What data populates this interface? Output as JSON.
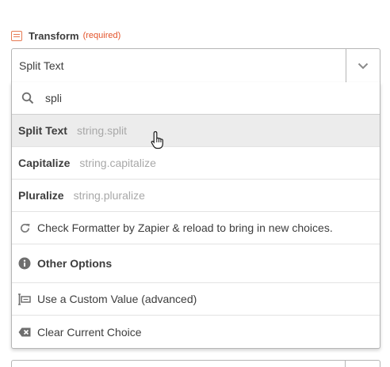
{
  "field": {
    "label": "Transform",
    "required_tag": "(required)",
    "label_icon": "formatter-icon",
    "accent_color": "#e3532a"
  },
  "select": {
    "value": "Split Text",
    "arrow_icon": "chevron-down-icon"
  },
  "search": {
    "value": "spli",
    "icon": "search-icon"
  },
  "options": [
    {
      "name": "Split Text",
      "key": "string.split",
      "highlighted": true
    },
    {
      "name": "Capitalize",
      "key": "string.capitalize",
      "highlighted": false
    },
    {
      "name": "Pluralize",
      "key": "string.pluralize",
      "highlighted": false
    }
  ],
  "actions": {
    "reload": "Check Formatter by Zapier & reload to bring in new choices.",
    "other_options": "Other Options",
    "custom_value": "Use a Custom Value (advanced)",
    "clear_choice": "Clear Current Choice"
  }
}
